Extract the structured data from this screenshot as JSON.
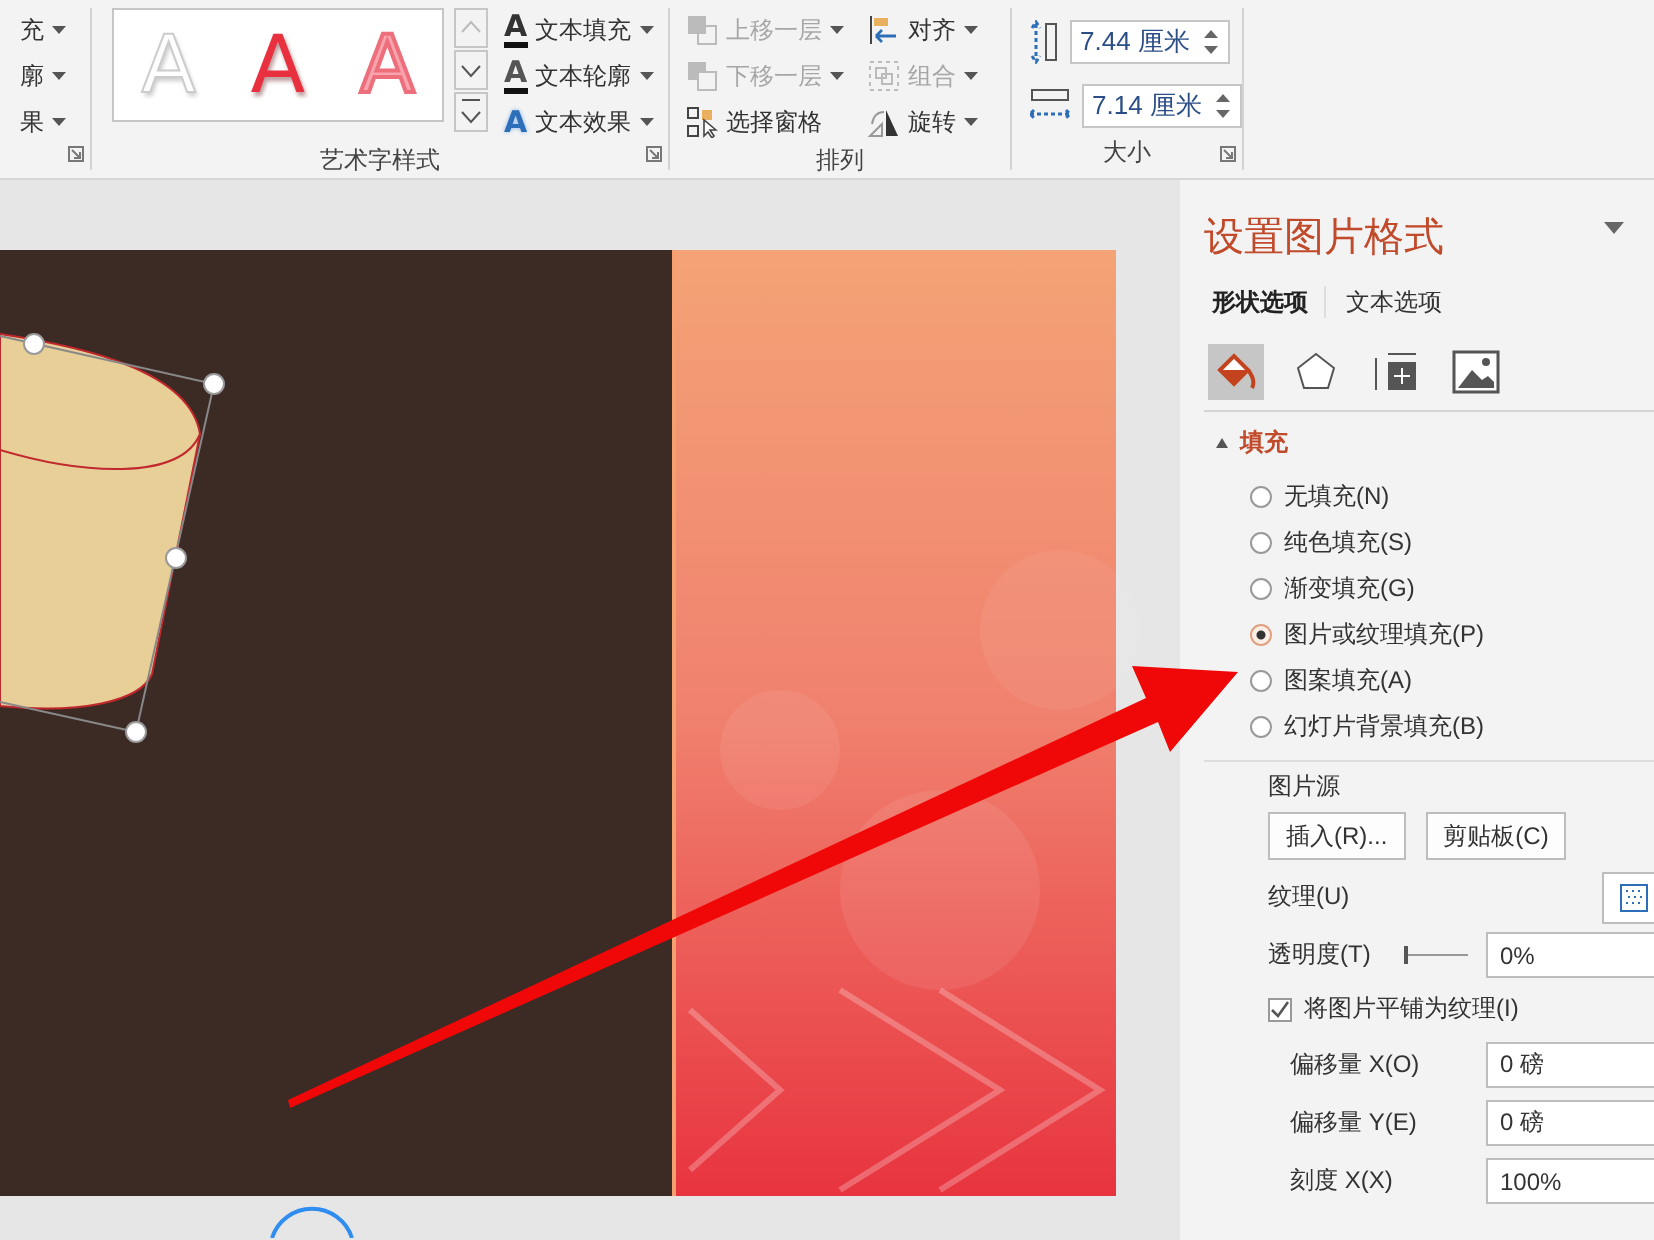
{
  "ribbon": {
    "shape_styles": {
      "items": [
        {
          "label": "充"
        },
        {
          "label": "廓"
        },
        {
          "label": "果"
        }
      ]
    },
    "wordart_styles": {
      "label": "艺术字样式",
      "gallery": [
        {
          "text": "A",
          "kind": "outline"
        },
        {
          "text": "A",
          "kind": "fill"
        },
        {
          "text": "A",
          "kind": "glow"
        }
      ],
      "commands": [
        {
          "glyph": "A",
          "label": "文本填充",
          "kind": "fill"
        },
        {
          "glyph": "A",
          "label": "文本轮廓",
          "kind": "outline"
        },
        {
          "glyph": "A",
          "label": "文本效果",
          "kind": "effects"
        }
      ]
    },
    "arrange": {
      "label": "排列",
      "commands": [
        {
          "label": "上移一层",
          "kind": "bring_forward",
          "disabled": true
        },
        {
          "label": "下移一层",
          "kind": "send_backward",
          "disabled": true
        },
        {
          "label": "选择窗格",
          "kind": "selection_pane",
          "disabled": false
        },
        {
          "label": "对齐",
          "kind": "align",
          "disabled": false
        },
        {
          "label": "组合",
          "kind": "group",
          "disabled": true
        },
        {
          "label": "旋转",
          "kind": "rotate",
          "disabled": false
        }
      ]
    },
    "size": {
      "label": "大小",
      "fields": [
        {
          "kind": "height",
          "value": "7.44 厘米"
        },
        {
          "kind": "width",
          "value": "7.14 厘米"
        }
      ]
    }
  },
  "format_pane": {
    "title": "设置图片格式",
    "tabs": [
      {
        "label": "形状选项",
        "selected": true
      },
      {
        "label": "文本选项",
        "selected": false
      }
    ],
    "icon_tabs": [
      {
        "kind": "fill",
        "selected": true
      },
      {
        "kind": "effects",
        "selected": false
      },
      {
        "kind": "size",
        "selected": false
      },
      {
        "kind": "picture",
        "selected": false
      }
    ],
    "section": {
      "title": "填充",
      "expanded": true
    },
    "fill_options": [
      {
        "label": "无填充(N)",
        "selected": false
      },
      {
        "label": "纯色填充(S)",
        "selected": false
      },
      {
        "label": "渐变填充(G)",
        "selected": false
      },
      {
        "label": "图片或纹理填充(P)",
        "selected": true
      },
      {
        "label": "图案填充(A)",
        "selected": false
      },
      {
        "label": "幻灯片背景填充(B)",
        "selected": false
      }
    ],
    "picture_source": {
      "label": "图片源",
      "buttons": [
        "插入(R)...",
        "剪贴板(C)"
      ]
    },
    "texture": {
      "label": "纹理(U)"
    },
    "transparency": {
      "label": "透明度(T)",
      "level": 0,
      "value": "0%"
    },
    "tile": {
      "label": "将图片平铺为纹理(I)",
      "checked": true
    },
    "tile_fields": [
      {
        "label": "偏移量 X(O)",
        "value": "0 磅"
      },
      {
        "label": "偏移量 Y(E)",
        "value": "0 磅"
      },
      {
        "label": "刻度 X(X)",
        "value": "100%"
      }
    ]
  }
}
